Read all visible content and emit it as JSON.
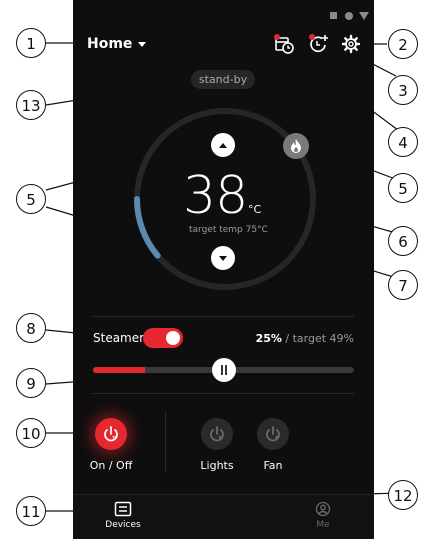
{
  "header": {
    "location": "Home"
  },
  "status_pill": "stand-by",
  "thermostat": {
    "temperature": "38",
    "unit": "°C",
    "target_label": "target temp 75°C"
  },
  "steamer": {
    "label": "Steamer",
    "on": true,
    "percent": "25%",
    "target": " / target 49%",
    "level": 0.25
  },
  "controls": [
    {
      "label": "On / Off",
      "active": true
    },
    {
      "label": "Lights",
      "active": false
    },
    {
      "label": "Fan",
      "active": false
    }
  ],
  "tabs": [
    {
      "label": "Devices",
      "active": true
    },
    {
      "label": "Me",
      "active": false
    }
  ],
  "callouts": [
    "1",
    "2",
    "3",
    "4",
    "5",
    "5",
    "6",
    "7",
    "8",
    "9",
    "10",
    "11",
    "12",
    "13"
  ],
  "colors": {
    "accent": "#e5272f",
    "arc": "#5a8ab0",
    "background": "#0e0e0e"
  },
  "icons": [
    "calendar-clock-icon",
    "timer-add-icon",
    "gear-icon",
    "flame-icon",
    "devices-icon",
    "person-icon"
  ]
}
